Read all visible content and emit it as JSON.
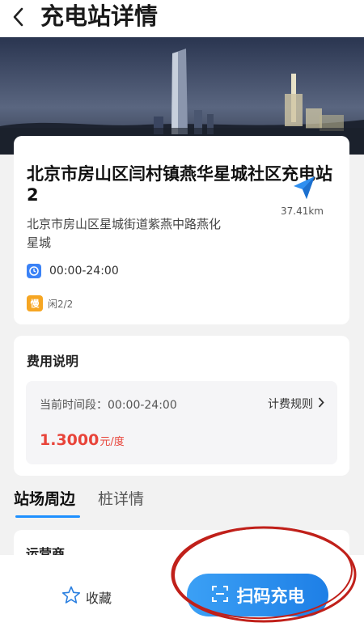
{
  "header": {
    "title": "充电站详情",
    "back_icon": "back-icon"
  },
  "station": {
    "name": "北京市房山区闫村镇燕华星城社区充电站2",
    "distance": "37.41km",
    "address": "北京市房山区星城街道紫燕中路燕化星城",
    "hours": "00:00-24:00",
    "slow_badge": "慢",
    "idle_status": "闲2/2"
  },
  "fee": {
    "title": "费用说明",
    "period": "当前时间段：00:00-24:00",
    "rules_link": "计费规则",
    "price": "1.3000",
    "price_unit": "元/度"
  },
  "tabs": [
    {
      "label": "站场周边",
      "active": true
    },
    {
      "label": "桩详情",
      "active": false
    }
  ],
  "operator": {
    "label": "运营商"
  },
  "bottom": {
    "favorite_label": "收藏",
    "scan_label": "扫码充电"
  },
  "colors": {
    "accent": "#1e7fe6",
    "price": "#e8443a",
    "slow_badge": "#f6a623",
    "annotation": "#c0201a"
  }
}
